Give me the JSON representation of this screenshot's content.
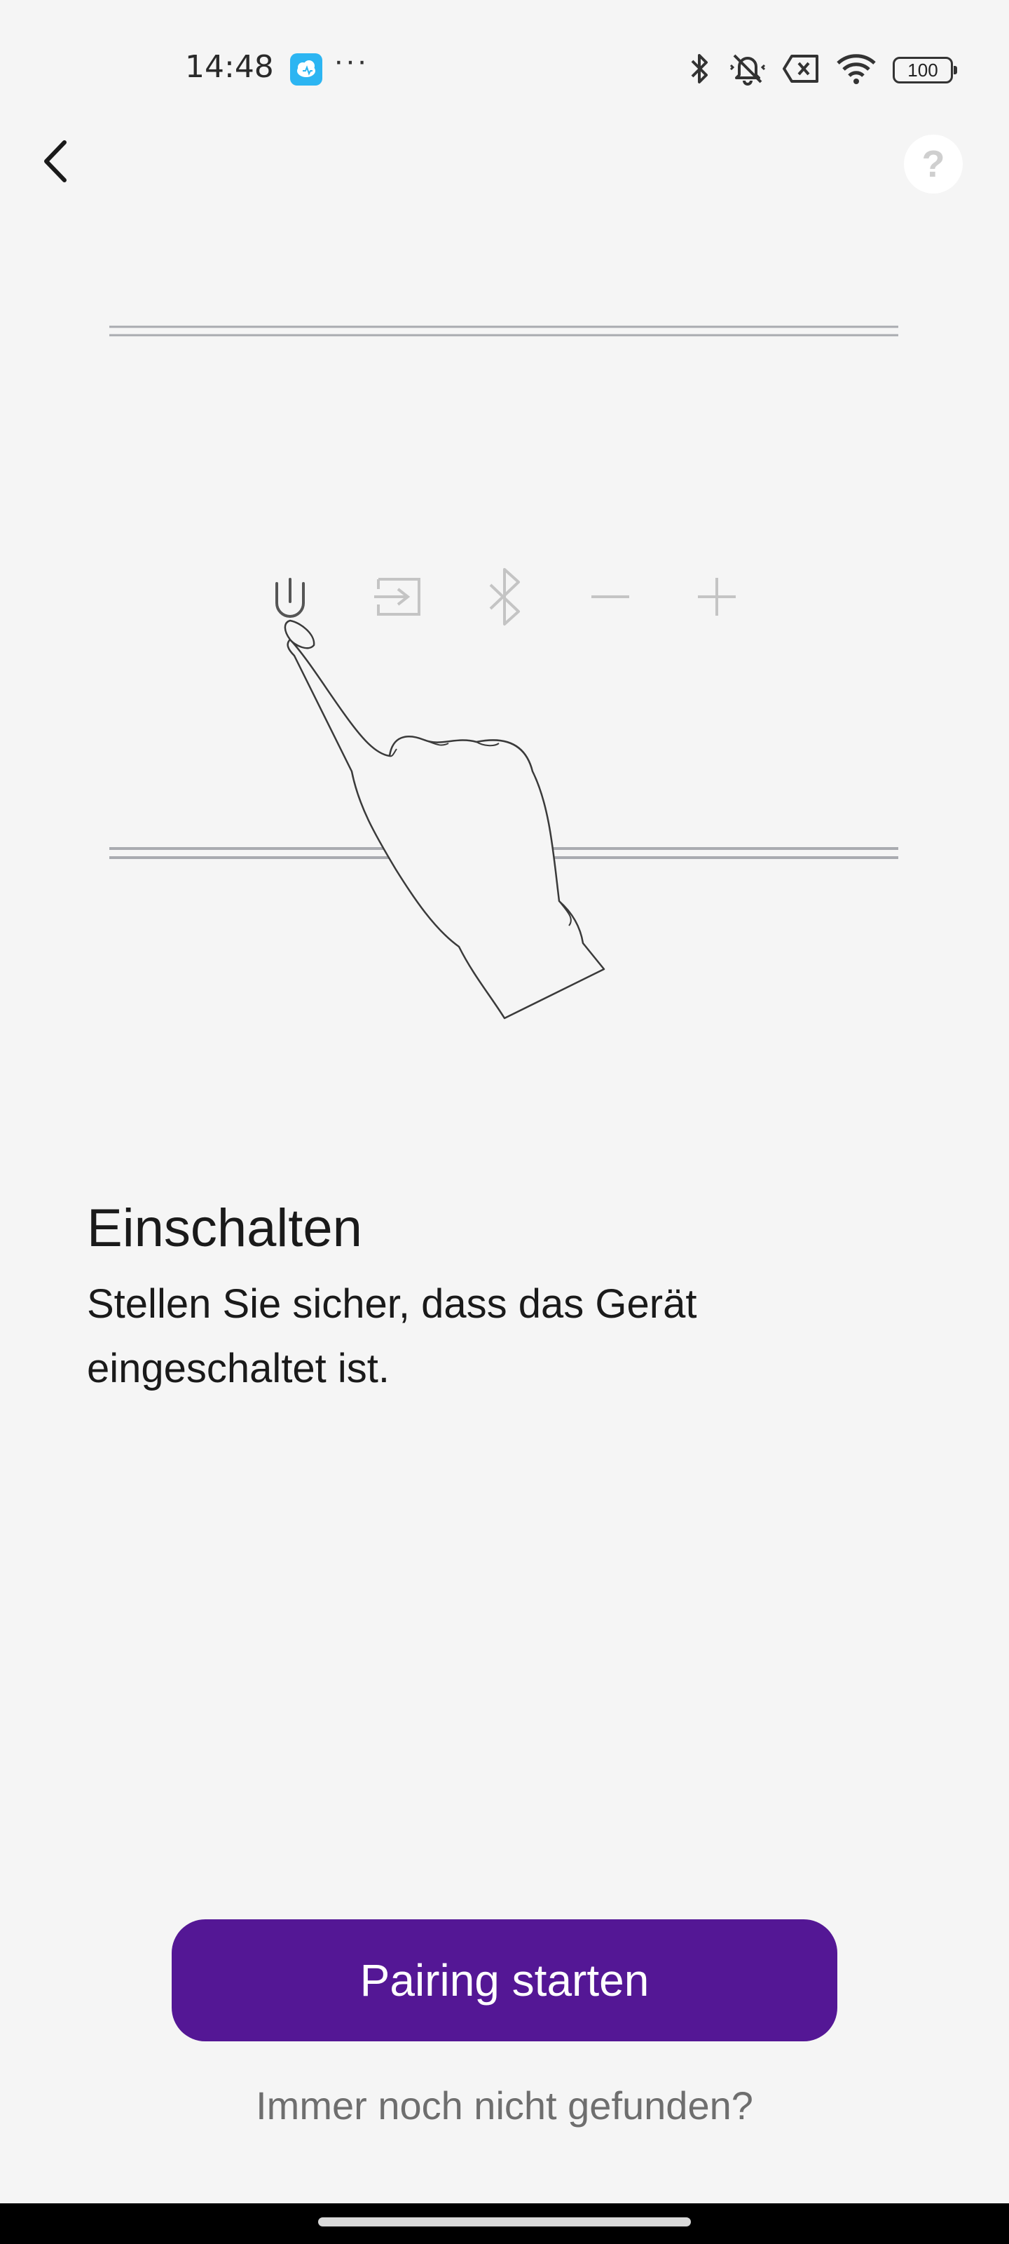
{
  "status_bar": {
    "time": "14:48",
    "more_indicator": "···",
    "battery_level": "100",
    "icons": [
      "bluetooth-icon",
      "mute-vibrate-icon",
      "no-sim-icon",
      "wifi-icon",
      "battery-icon"
    ],
    "app_icon_color": "#2cb5f2"
  },
  "header": {
    "back_icon": "chevron-left-icon",
    "help_label": "?"
  },
  "illustration": {
    "device_buttons": [
      "power-icon",
      "input-source-icon",
      "bluetooth-icon",
      "volume-down-icon",
      "volume-up-icon"
    ],
    "highlighted_button": "power-icon"
  },
  "instruction": {
    "title": "Einschalten",
    "description": "Stellen Sie sicher, dass das Gerät eingeschaltet ist."
  },
  "actions": {
    "primary_label": "Pairing starten",
    "secondary_label": "Immer noch nicht gefunden?"
  },
  "colors": {
    "background": "#f5f5f5",
    "primary_button": "#541795",
    "primary_text": "#ffffff",
    "secondary_text": "#6e6e6e"
  }
}
